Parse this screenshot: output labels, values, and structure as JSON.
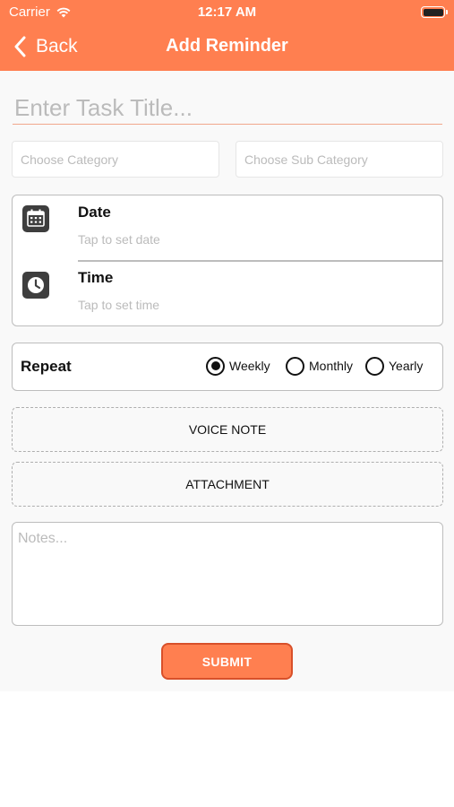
{
  "status_bar": {
    "carrier": "Carrier",
    "time": "12:17 AM",
    "icons": [
      "wifi-icon",
      "battery-icon"
    ]
  },
  "nav": {
    "back_label": "Back",
    "title": "Add Reminder",
    "back_icon": "chevron-left-icon"
  },
  "colors": {
    "accent": "#FF7F50",
    "accent_border": "#D8502A",
    "placeholder": "#BBBBBB",
    "background": "#F9F9F9"
  },
  "form": {
    "task_title": {
      "value": "",
      "placeholder": "Enter Task Title..."
    },
    "category": {
      "placeholder": "Choose Category"
    },
    "sub_category": {
      "placeholder": "Choose Sub Category"
    },
    "date": {
      "label": "Date",
      "hint": "Tap to set date",
      "icon": "calendar-icon"
    },
    "time": {
      "label": "Time",
      "hint": "Tap to set time",
      "icon": "clock-icon"
    },
    "repeat": {
      "label": "Repeat",
      "options": [
        {
          "label": "Weekly",
          "selected": true
        },
        {
          "label": "Monthly",
          "selected": false
        },
        {
          "label": "Yearly",
          "selected": false
        }
      ]
    },
    "voice_note_label": "VOICE NOTE",
    "attachment_label": "ATTACHMENT",
    "notes": {
      "value": "",
      "placeholder": "Notes..."
    },
    "submit_label": "SUBMIT"
  }
}
